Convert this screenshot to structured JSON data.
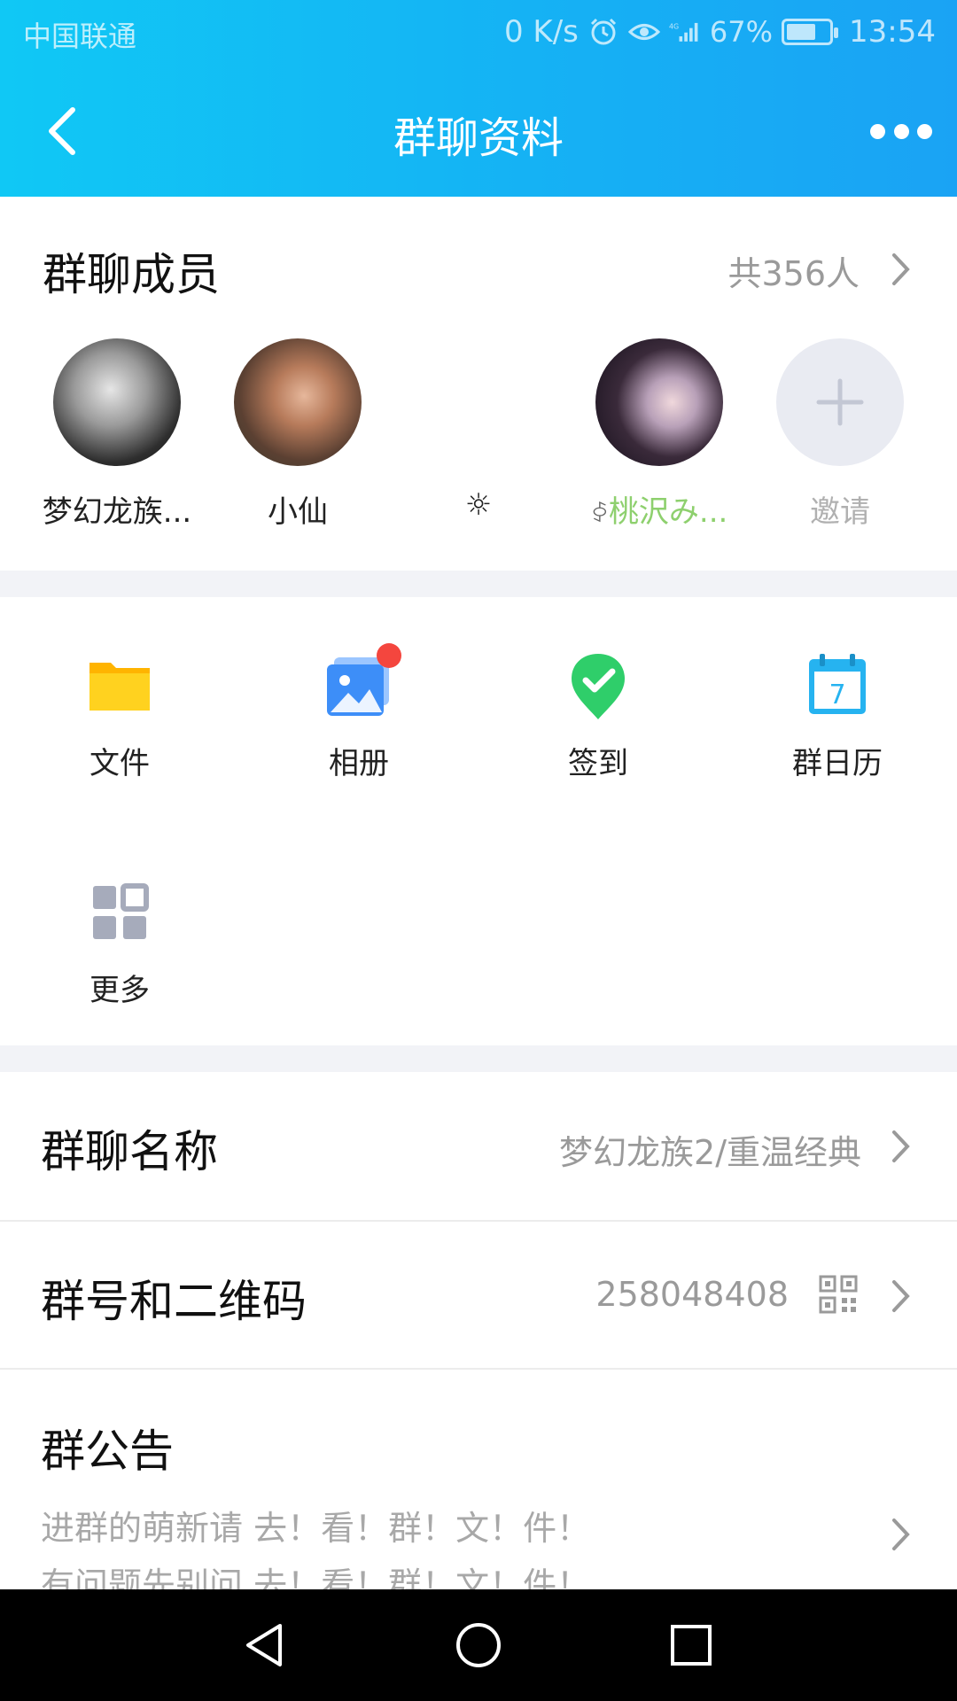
{
  "status_bar": {
    "carrier": "中国联通",
    "net_speed": "0 K/s",
    "network": "4G",
    "battery": "67%",
    "time": "13:54"
  },
  "header": {
    "title": "群聊资料",
    "back_icon": "back-chevron-icon",
    "more_icon": "more-dots-icon"
  },
  "members": {
    "title": "群聊成员",
    "count": "共356人",
    "list": [
      {
        "name": "梦幻龙族...",
        "avatar": "avatar-1"
      },
      {
        "name": "小仙",
        "avatar": "avatar-2"
      },
      {
        "name": "☼",
        "avatar": ""
      },
      {
        "name": "桃沢み...",
        "prefix": "ꀆ",
        "avatar": "avatar-4"
      },
      {
        "name": "邀请",
        "avatar": "invite-plus-icon"
      }
    ]
  },
  "apps": [
    {
      "label": "文件",
      "icon": "folder-icon"
    },
    {
      "label": "相册",
      "icon": "photo-album-icon",
      "badge": true
    },
    {
      "label": "签到",
      "icon": "checkin-icon"
    },
    {
      "label": "群日历",
      "icon": "calendar-icon",
      "calendar_day": "7"
    },
    {
      "label": "更多",
      "icon": "grid-more-icon"
    }
  ],
  "rows": {
    "group_name": {
      "label": "群聊名称",
      "value": "梦幻龙族2/重温经典"
    },
    "group_number": {
      "label": "群号和二维码",
      "value": "258048408"
    },
    "notice": {
      "label": "群公告",
      "line1": "进群的萌新请 去！看！群！文！件！",
      "line2": "有问题先别问 去！看！群！文！件！"
    }
  },
  "colors": {
    "header_start": "#10c8f5",
    "header_end": "#1aa3f4",
    "badge_red": "#f4463e",
    "folder_yellow": "#ffc400",
    "checkin_green": "#2fce6a",
    "album_blue": "#3d8ef8",
    "calendar_blue": "#26b3f0"
  }
}
